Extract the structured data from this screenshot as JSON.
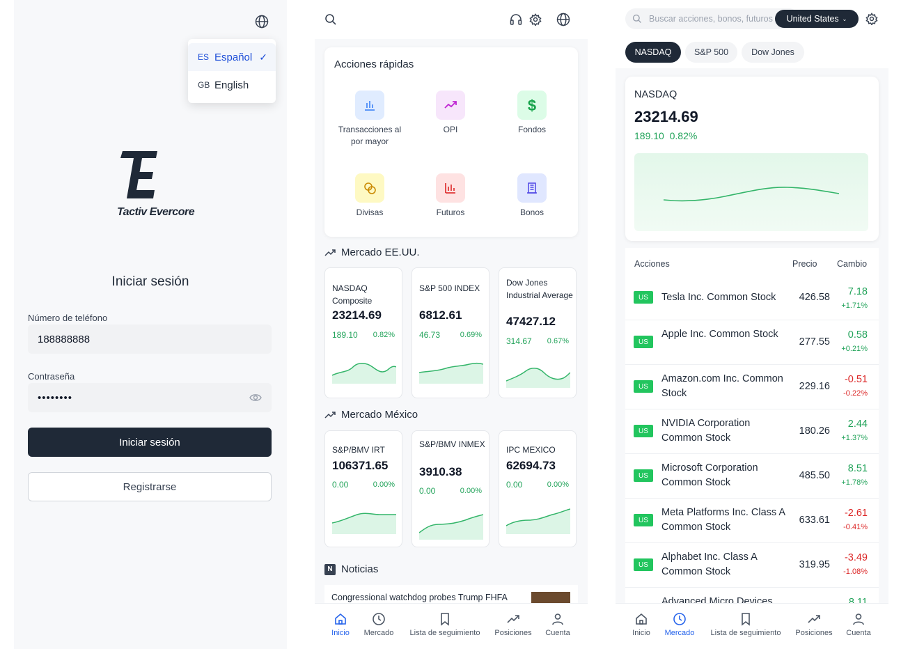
{
  "login": {
    "languages": [
      {
        "code": "ES",
        "label": "Español",
        "selected": true
      },
      {
        "code": "GB",
        "label": "English",
        "selected": false
      }
    ],
    "brand_name": "Tactiv Evercore",
    "logo_text": "TE",
    "title": "Iniciar sesión",
    "phone_label": "Número de teléfono",
    "phone_value": "188888888",
    "password_label": "Contraseña",
    "password_value": "••••••••",
    "login_button": "Iniciar sesión",
    "register_button": "Registrarse"
  },
  "home": {
    "quick_actions_title": "Acciones rápidas",
    "quick_actions": [
      {
        "label": "Transacciones al por mayor",
        "icon": "bar-chart-icon",
        "color": "#3b82f6",
        "bg": "#e0ecff"
      },
      {
        "label": "OPI",
        "icon": "trend-up-icon",
        "color": "#c026d3",
        "bg": "#f7e6fb"
      },
      {
        "label": "Fondos",
        "icon": "dollar-icon",
        "color": "#16a34a",
        "bg": "#dcfce7"
      },
      {
        "label": "Divisas",
        "icon": "coins-icon",
        "color": "#ca8a04",
        "bg": "#fef9c3"
      },
      {
        "label": "Futuros",
        "icon": "column-chart-icon",
        "color": "#dc2626",
        "bg": "#fee2e2"
      },
      {
        "label": "Bonos",
        "icon": "building-icon",
        "color": "#4f46e5",
        "bg": "#e0e7ff"
      }
    ],
    "us_market_title": "Mercado EE.UU.",
    "us_market": [
      {
        "name": "NASDAQ Composite",
        "value": "23214.69",
        "change": "189.10",
        "pct": "0.82%"
      },
      {
        "name": "S&P 500 INDEX",
        "value": "6812.61",
        "change": "46.73",
        "pct": "0.69%"
      },
      {
        "name": "Dow Jones Industrial Average",
        "value": "47427.12",
        "change": "314.67",
        "pct": "0.67%"
      }
    ],
    "mx_market_title": "Mercado México",
    "mx_market": [
      {
        "name": "S&P/BMV IRT",
        "value": "106371.65",
        "change": "0.00",
        "pct": "0.00%"
      },
      {
        "name": "S&P/BMV INMEX",
        "value": "3910.38",
        "change": "0.00",
        "pct": "0.00%"
      },
      {
        "name": "IPC MEXICO",
        "value": "62694.73",
        "change": "0.00",
        "pct": "0.00%"
      }
    ],
    "news_badge": "N",
    "news_title": "Noticias",
    "news_headline": "Congressional watchdog probes Trump FHFA"
  },
  "nav_home": [
    {
      "label": "Inicio",
      "icon": "home-icon",
      "active": true
    },
    {
      "label": "Mercado",
      "icon": "clock-icon",
      "active": false
    },
    {
      "label": "Lista de seguimiento",
      "icon": "bookmark-icon",
      "active": false
    },
    {
      "label": "Posiciones",
      "icon": "trend-icon",
      "active": false
    },
    {
      "label": "Cuenta",
      "icon": "user-icon",
      "active": false
    }
  ],
  "market": {
    "search_placeholder": "Buscar acciones, bonos, futuros",
    "region": "United States",
    "tabs": [
      {
        "label": "NASDAQ",
        "active": true
      },
      {
        "label": "S&P 500",
        "active": false
      },
      {
        "label": "Dow Jones",
        "active": false
      }
    ],
    "index_name": "NASDAQ",
    "index_value": "23214.69",
    "index_change": "189.10",
    "index_pct": "0.82%",
    "table_headers": {
      "stocks": "Acciones",
      "price": "Precio",
      "change": "Cambio"
    },
    "stocks": [
      {
        "badge": "US",
        "name": "Tesla Inc. Common Stock",
        "price": "426.58",
        "change": "7.18",
        "pct": "+1.71%",
        "dir": "up"
      },
      {
        "badge": "US",
        "name": "Apple Inc. Common Stock",
        "price": "277.55",
        "change": "0.58",
        "pct": "+0.21%",
        "dir": "up"
      },
      {
        "badge": "US",
        "name": "Amazon.com Inc. Common Stock",
        "price": "229.16",
        "change": "-0.51",
        "pct": "-0.22%",
        "dir": "down"
      },
      {
        "badge": "US",
        "name": "NVIDIA Corporation Common Stock",
        "price": "180.26",
        "change": "2.44",
        "pct": "+1.37%",
        "dir": "up"
      },
      {
        "badge": "US",
        "name": "Microsoft Corporation Common Stock",
        "price": "485.50",
        "change": "8.51",
        "pct": "+1.78%",
        "dir": "up"
      },
      {
        "badge": "US",
        "name": "Meta Platforms Inc. Class A Common Stock",
        "price": "633.61",
        "change": "-2.61",
        "pct": "-0.41%",
        "dir": "down"
      },
      {
        "badge": "US",
        "name": "Alphabet Inc. Class A Common Stock",
        "price": "319.95",
        "change": "-3.49",
        "pct": "-1.08%",
        "dir": "down"
      },
      {
        "badge": "US",
        "name": "Advanced Micro Devices",
        "price": "",
        "change": "8.11",
        "pct": "",
        "dir": "up"
      }
    ]
  },
  "nav_market": [
    {
      "label": "Inicio",
      "icon": "home-icon",
      "active": false
    },
    {
      "label": "Mercado",
      "icon": "clock-icon",
      "active": true
    },
    {
      "label": "Lista de seguimiento",
      "icon": "bookmark-icon",
      "active": false
    },
    {
      "label": "Posiciones",
      "icon": "trend-icon",
      "active": false
    },
    {
      "label": "Cuenta",
      "icon": "user-icon",
      "active": false
    }
  ]
}
